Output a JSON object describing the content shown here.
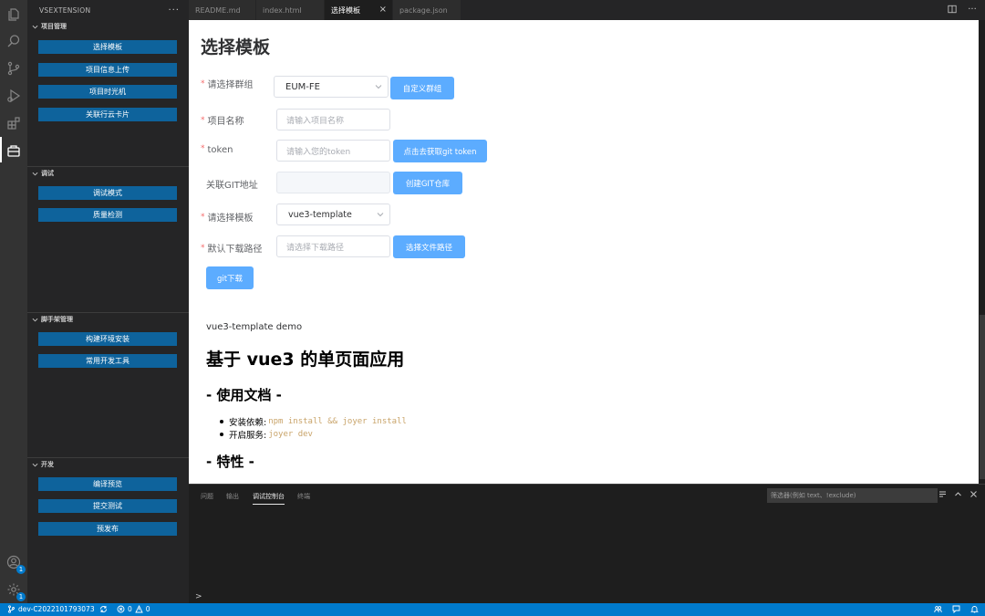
{
  "sidebar": {
    "title": "VSEXTENSION",
    "sections": [
      {
        "title": "项目管理",
        "buttons": [
          "选择模板",
          "项目信息上传",
          "项目时光机",
          "关联行云卡片"
        ]
      },
      {
        "title": "调试",
        "buttons": [
          "调试模式",
          "质量检测"
        ]
      },
      {
        "title": "脚手架管理",
        "buttons": [
          "构建环境安装",
          "常用开发工具"
        ]
      },
      {
        "title": "开发",
        "buttons": [
          "编译预览",
          "提交测试",
          "预发布"
        ]
      }
    ]
  },
  "activity_bar": {
    "icons": [
      "files-icon",
      "search-icon",
      "source-control-icon",
      "run-debug-icon",
      "extensions-icon",
      "vsextension-icon",
      "account-icon",
      "settings-icon"
    ],
    "account_badge": "1",
    "settings_badge": "1"
  },
  "tabs": [
    {
      "label": "README.md",
      "active": false
    },
    {
      "label": "index.html",
      "active": false
    },
    {
      "label": "选择模板",
      "active": true
    },
    {
      "label": "package.json",
      "active": false
    }
  ],
  "webview": {
    "title": "选择模板",
    "form": {
      "group_label": "请选择群组",
      "group_value": "EUM-FE",
      "group_button": "自定义群组",
      "name_label": "项目名称",
      "name_placeholder": "请输入项目名称",
      "token_label": "token",
      "token_placeholder": "请输入您的token",
      "token_button": "点击去获取git token",
      "git_label": "关联GIT地址",
      "git_button": "创建GIT仓库",
      "template_label": "请选择模板",
      "template_value": "vue3-template",
      "path_label": "默认下载路径",
      "path_placeholder": "请选择下载路径",
      "path_button": "选择文件路径",
      "download_button": "git下载"
    },
    "readme": {
      "demo_label": "vue3-template demo",
      "h1": "基于 vue3 的单页面应用",
      "docs_heading": "- 使用文档 -",
      "items": [
        {
          "label": "安装依赖:",
          "code": "npm install && joyer install"
        },
        {
          "label": "开启服务:",
          "code": "joyer dev"
        }
      ],
      "features_heading": "- 特性 -"
    }
  },
  "panel": {
    "tabs": [
      "问题",
      "输出",
      "调试控制台",
      "终端"
    ],
    "active_tab": "调试控制台",
    "filter_placeholder": "筛选器(例如 text、!exclude)",
    "prompt": ">"
  },
  "statusbar": {
    "branch": "dev-C2022101793073",
    "errors": "0",
    "warnings": "0"
  },
  "colors": {
    "accent": "#007acc",
    "sidebar_button": "#0e639c",
    "primary_button": "#409eff",
    "required": "#f56c6c",
    "code": "#c9a46a"
  }
}
